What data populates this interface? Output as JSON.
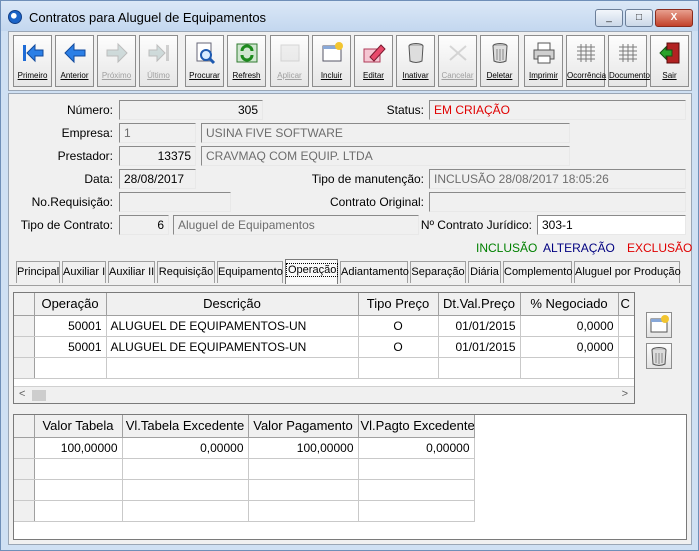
{
  "window": {
    "title": "Contratos para Aluguel de Equipamentos",
    "minimize": "_",
    "maximize": "□",
    "close": "X"
  },
  "toolbar": [
    {
      "label": "Primeiro",
      "icon": "first-record-icon",
      "enabled": true
    },
    {
      "label": "Anterior",
      "icon": "previous-record-icon",
      "enabled": true
    },
    {
      "label": "Próximo",
      "icon": "next-record-icon",
      "enabled": false
    },
    {
      "label": "Último",
      "icon": "last-record-icon",
      "enabled": false
    },
    {
      "label": "Procurar",
      "icon": "search-icon",
      "enabled": true
    },
    {
      "label": "Refresh",
      "icon": "refresh-icon",
      "enabled": true
    },
    {
      "label": "Aplicar",
      "icon": "apply-icon",
      "enabled": false
    },
    {
      "label": "Incluir",
      "icon": "add-record-icon",
      "enabled": true
    },
    {
      "label": "Editar",
      "icon": "edit-icon",
      "enabled": true
    },
    {
      "label": "Inativar",
      "icon": "deactivate-icon",
      "enabled": true
    },
    {
      "label": "Cancelar",
      "icon": "cancel-icon",
      "enabled": false
    },
    {
      "label": "Deletar",
      "icon": "delete-icon",
      "enabled": true
    },
    {
      "label": "Imprimir",
      "icon": "print-icon",
      "enabled": true
    },
    {
      "label": "Ocorrência",
      "icon": "occurrence-grid-icon",
      "enabled": true
    },
    {
      "label": "Documento",
      "icon": "document-grid-icon",
      "enabled": true
    },
    {
      "label": "Sair",
      "icon": "exit-icon",
      "enabled": true
    }
  ],
  "form": {
    "numero_label": "Número:",
    "numero": "305",
    "status_label": "Status:",
    "status": "EM CRIAÇÃO",
    "empresa_label": "Empresa:",
    "empresa_code": "1",
    "empresa_name": "USINA FIVE SOFTWARE",
    "prestador_label": "Prestador:",
    "prestador_code": "13375",
    "prestador_name": "CRAVMAQ COM EQUIP. LTDA",
    "data_label": "Data:",
    "data": "28/08/2017",
    "tipo_manutencao_label": "Tipo de manutenção:",
    "tipo_manutencao": "INCLUSÃO 28/08/2017 18:05:26",
    "requisicao_label": "No.Requisição:",
    "requisicao": "",
    "contrato_original_label": "Contrato Original:",
    "contrato_original": "",
    "tipo_contrato_label": "Tipo de Contrato:",
    "tipo_contrato_code": "6",
    "tipo_contrato_name": "Aluguel de Equipamentos",
    "contrato_juridico_label": "Nº Contrato Jurídico:",
    "contrato_juridico": "303-1"
  },
  "legend": {
    "inclusao": "INCLUSÃO",
    "alteracao": "ALTERAÇÃO",
    "exclusao": "EXCLUSÃO",
    "colors": {
      "inclusao": "#008000",
      "alteracao": "#000080",
      "exclusao": "#e00000"
    }
  },
  "tabs": [
    "Principal",
    "Auxiliar I",
    "Auxiliar II",
    "Requisição",
    "Equipamento",
    "Operação",
    "Adiantamento",
    "Separação",
    "Diária",
    "Complemento",
    "Aluguel por Produção"
  ],
  "active_tab": "Operação",
  "operations_grid": {
    "headers": [
      "Operação",
      "Descrição",
      "Tipo Preço",
      "Dt.Val.Preço",
      "% Negociado",
      "C"
    ],
    "rows": [
      [
        "50001",
        "ALUGUEL DE EQUIPAMENTOS-UN",
        "O",
        "01/01/2015",
        "0,0000"
      ],
      [
        "50001",
        "ALUGUEL DE EQUIPAMENTOS-UN",
        "O",
        "01/01/2015",
        "0,0000"
      ]
    ]
  },
  "values_grid": {
    "headers": [
      "Valor Tabela",
      "Vl.Tabela Excedente",
      "Valor Pagamento",
      "Vl.Pagto Excedente"
    ],
    "rows": [
      [
        "100,00000",
        "0,00000",
        "100,00000",
        "0,00000"
      ]
    ]
  },
  "scroll": {
    "left": "<",
    "right": ">"
  },
  "colors": {
    "status": "#e00000"
  }
}
